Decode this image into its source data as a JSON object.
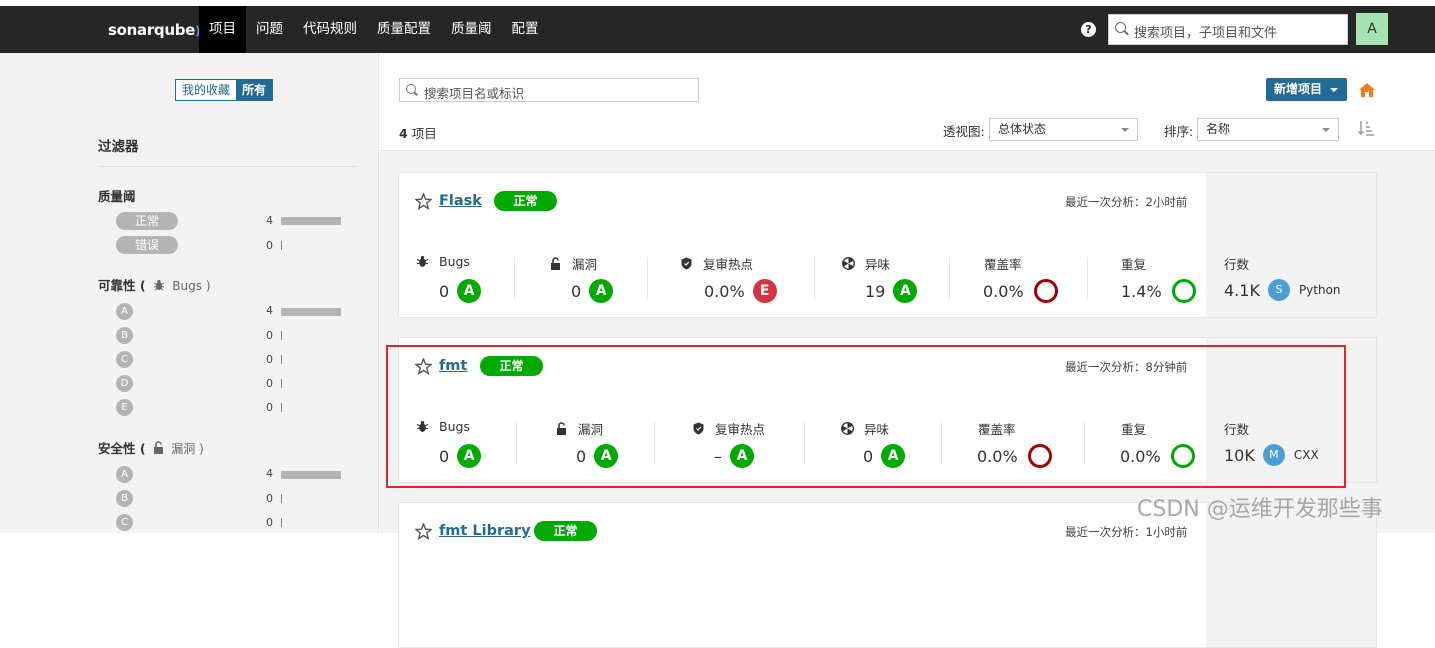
{
  "topbar": {
    "logo": "sonarqube",
    "nav": [
      {
        "label": "项目",
        "active": true
      },
      {
        "label": "问题"
      },
      {
        "label": "代码规则"
      },
      {
        "label": "质量配置"
      },
      {
        "label": "质量阈"
      },
      {
        "label": "配置"
      }
    ],
    "help": "?",
    "search_placeholder": "搜索项目，子项目和文件",
    "avatar": "A"
  },
  "sidebar": {
    "toggle": {
      "favorites": "我的收藏",
      "all": "所有"
    },
    "filters_title": "过滤器",
    "quality_gate": {
      "title": "质量阈",
      "items": [
        {
          "label": "正常",
          "count": "4"
        },
        {
          "label": "错误",
          "count": "0"
        }
      ]
    },
    "reliability": {
      "title": "可靠性 (",
      "sub": "Bugs )",
      "items": [
        {
          "label": "A",
          "count": "4"
        },
        {
          "label": "B",
          "count": "0"
        },
        {
          "label": "C",
          "count": "0"
        },
        {
          "label": "D",
          "count": "0"
        },
        {
          "label": "E",
          "count": "0"
        }
      ]
    },
    "security": {
      "title": "安全性 (",
      "sub": "漏洞 )",
      "items": [
        {
          "label": "A",
          "count": "4"
        },
        {
          "label": "B",
          "count": "0"
        },
        {
          "label": "C",
          "count": "0"
        }
      ]
    }
  },
  "main": {
    "search_placeholder": "搜索项目名或标识",
    "count_num": "4",
    "count_label": "项目",
    "new_project": "新增项目",
    "perspective_label": "透视图:",
    "perspective_value": "总体状态",
    "sort_label": "排序:",
    "sort_value": "名称",
    "colors": {
      "rating_a": "#00aa00",
      "rating_e": "#d4333f",
      "accent": "#236a97"
    }
  },
  "projects": [
    {
      "name": "Flask",
      "qg": "正常",
      "last_analysis": "最近一次分析：2小时前",
      "bugs_label": "Bugs",
      "bugs": "0",
      "bugs_rating": "A",
      "vuln_label": "漏洞",
      "vuln": "0",
      "vuln_rating": "A",
      "hotspot_label": "复审热点",
      "hotspot": "0.0%",
      "hotspot_rating": "E",
      "smell_label": "异味",
      "smell": "19",
      "smell_rating": "A",
      "coverage_label": "覆盖率",
      "coverage": "0.0%",
      "dup_label": "重复",
      "dup": "1.4%",
      "lines_label": "行数",
      "lines": "4.1K",
      "lang_badge": "S",
      "lang": "Python"
    },
    {
      "name": "fmt",
      "qg": "正常",
      "last_analysis": "最近一次分析：8分钟前",
      "bugs_label": "Bugs",
      "bugs": "0",
      "bugs_rating": "A",
      "vuln_label": "漏洞",
      "vuln": "0",
      "vuln_rating": "A",
      "hotspot_label": "复审热点",
      "hotspot": "–",
      "hotspot_rating": "A",
      "smell_label": "异味",
      "smell": "0",
      "smell_rating": "A",
      "coverage_label": "覆盖率",
      "coverage": "0.0%",
      "dup_label": "重复",
      "dup": "0.0%",
      "lines_label": "行数",
      "lines": "10K",
      "lang_badge": "M",
      "lang": "CXX"
    },
    {
      "name": "fmt Library",
      "qg": "正常",
      "last_analysis": "最近一次分析：1小时前"
    }
  ],
  "watermark": "CSDN @运维开发那些事"
}
